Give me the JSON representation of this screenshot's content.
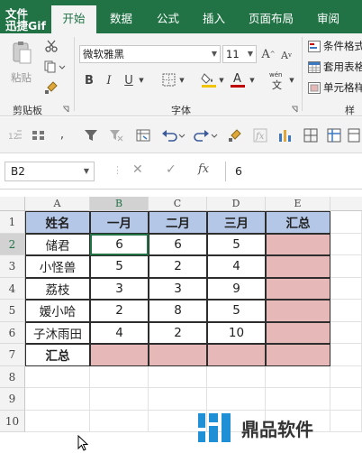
{
  "tabs": {
    "watermark": [
      "文件",
      "迅捷Gif"
    ],
    "active": "开始",
    "items": [
      "数据",
      "公式",
      "插入",
      "页面布局",
      "审阅"
    ]
  },
  "ribbon": {
    "clipboard": {
      "paste": "粘贴",
      "label": "剪贴板"
    },
    "font": {
      "name": "微软雅黑",
      "size": "11",
      "label": "字体",
      "bold": "B",
      "italic": "I",
      "underline": "U"
    },
    "styles": {
      "conditional": "条件格式",
      "table": "套用表格",
      "cell": "单元格样",
      "label": "样式"
    }
  },
  "formula_bar": {
    "name_box": "B2",
    "fx": "fx",
    "value": "6"
  },
  "sheet": {
    "columns": [
      "A",
      "B",
      "C",
      "D",
      "E"
    ],
    "rows": [
      "1",
      "2",
      "3",
      "4",
      "5",
      "6",
      "7",
      "8",
      "9",
      "10"
    ],
    "header": [
      "姓名",
      "一月",
      "二月",
      "三月",
      "汇总"
    ],
    "data": [
      [
        "储君",
        "6",
        "6",
        "5",
        ""
      ],
      [
        "小怪兽",
        "5",
        "2",
        "4",
        ""
      ],
      [
        "荔枝",
        "3",
        "3",
        "9",
        ""
      ],
      [
        "媛小哈",
        "2",
        "8",
        "5",
        ""
      ],
      [
        "子沐雨田",
        "4",
        "2",
        "10",
        ""
      ]
    ],
    "total_label": "汇总",
    "colors": {
      "header": "#b4c7e7",
      "highlight": "#e6b8b7",
      "accent": "#217346"
    }
  },
  "logo": {
    "text": "鼎品软件"
  }
}
